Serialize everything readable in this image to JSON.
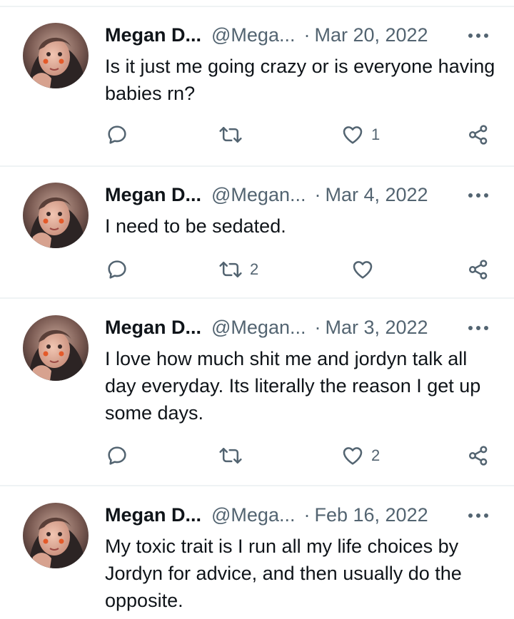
{
  "colors": {
    "text_primary": "#0f1419",
    "text_secondary": "#536471",
    "divider": "#eff3f4"
  },
  "icons": {
    "reply": "reply-icon",
    "retweet": "retweet-icon",
    "like": "heart-icon",
    "share": "share-icon",
    "more": "more-options-icon"
  },
  "tweets": [
    {
      "name": "Megan D...",
      "handle": "@Mega...",
      "separator": "·",
      "date": "Mar 20, 2022",
      "text": "Is it just me going crazy or is everyone having babies rn?",
      "replies": "",
      "retweets": "",
      "likes": "1"
    },
    {
      "name": "Megan D...",
      "handle": "@Megan...",
      "separator": "·",
      "date": "Mar 4, 2022",
      "text": "I need to be sedated.",
      "replies": "",
      "retweets": "2",
      "likes": ""
    },
    {
      "name": "Megan D...",
      "handle": "@Megan...",
      "separator": "·",
      "date": "Mar 3, 2022",
      "text": "I love how much shit me and jordyn talk all day everyday. Its literally the reason I get up some days.",
      "replies": "",
      "retweets": "",
      "likes": "2"
    },
    {
      "name": "Megan D...",
      "handle": "@Mega...",
      "separator": "·",
      "date": "Feb 16, 2022",
      "text": "My toxic trait is I run all my life choices by Jordyn for advice, and then usually do the opposite.",
      "replies": "",
      "retweets": "",
      "likes": ""
    }
  ]
}
